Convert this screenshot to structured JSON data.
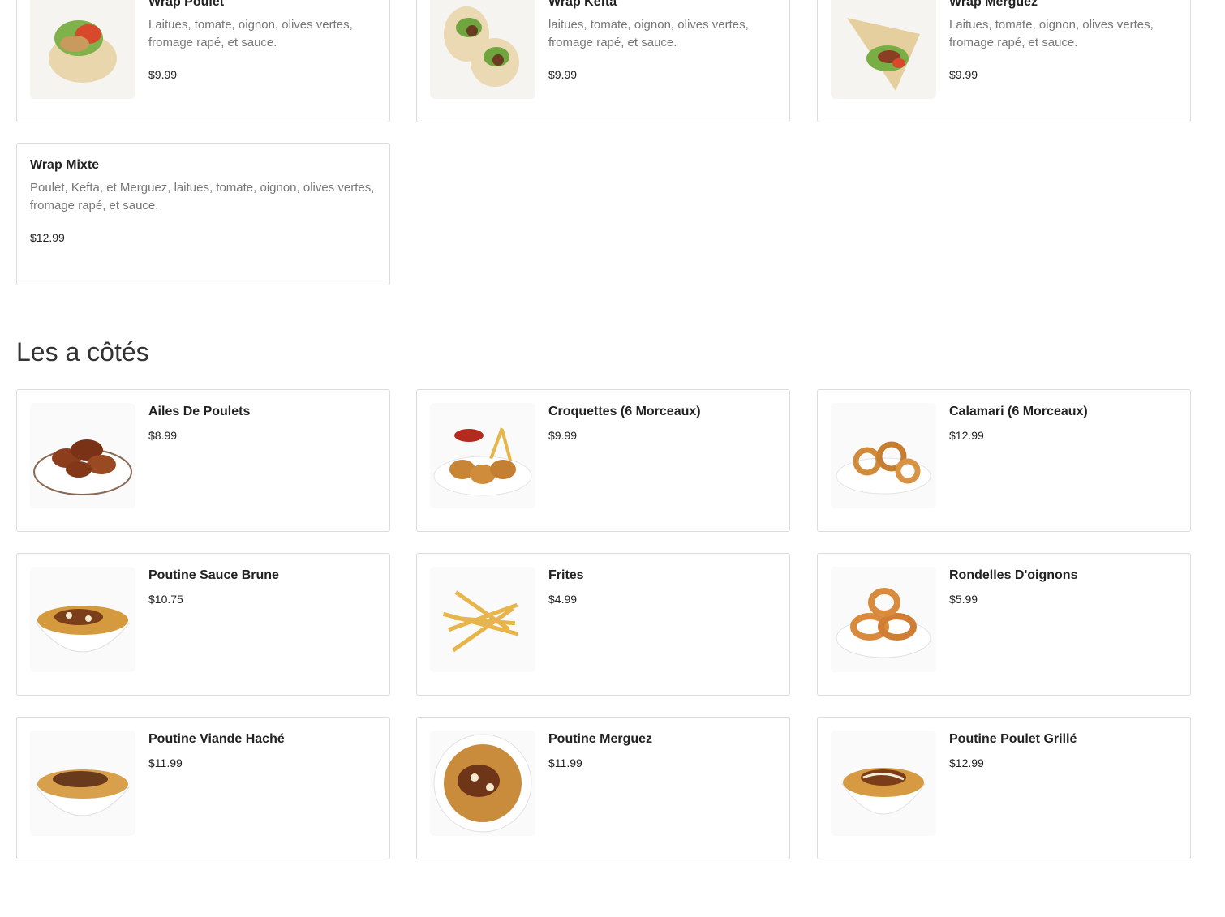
{
  "wraps": [
    {
      "name": "Wrap Poulet",
      "description": "Laitues, tomate, oignon, olives vertes, fromage rapé, et sauce.",
      "price": "$9.99",
      "image": "wrap-chicken-image"
    },
    {
      "name": "Wrap Kefta",
      "description": "laitues, tomate, oignon, olives vertes, fromage rapé, et sauce.",
      "price": "$9.99",
      "image": "wrap-kefta-image"
    },
    {
      "name": "Wrap Merguez",
      "description": "Laitues, tomate, oignon, olives vertes, fromage rapé, et sauce.",
      "price": "$9.99",
      "image": "wrap-merguez-image"
    },
    {
      "name": "Wrap Mixte",
      "description": "Poulet, Kefta, et Merguez, laitues, tomate, oignon, olives vertes, fromage rapé, et sauce.",
      "price": "$12.99"
    }
  ],
  "sides_section": {
    "title": "Les a côtés",
    "items": [
      {
        "name": "Ailes De Poulets",
        "price": "$8.99",
        "image": "chicken-wings-image"
      },
      {
        "name": "Croquettes (6 Morceaux)",
        "price": "$9.99",
        "image": "nuggets-image"
      },
      {
        "name": "Calamari (6 Morceaux)",
        "price": "$12.99",
        "image": "calamari-image"
      },
      {
        "name": "Poutine Sauce Brune",
        "price": "$10.75",
        "image": "poutine-image"
      },
      {
        "name": "Frites",
        "price": "$4.99",
        "image": "fries-image"
      },
      {
        "name": "Rondelles D'oignons",
        "price": "$5.99",
        "image": "onion-rings-image"
      },
      {
        "name": "Poutine Viande Haché",
        "price": "$11.99",
        "image": "poutine-image"
      },
      {
        "name": "Poutine Merguez",
        "price": "$11.99",
        "image": "poutine-image"
      },
      {
        "name": "Poutine Poulet Grillé",
        "price": "$12.99",
        "image": "poutine-image"
      }
    ]
  }
}
